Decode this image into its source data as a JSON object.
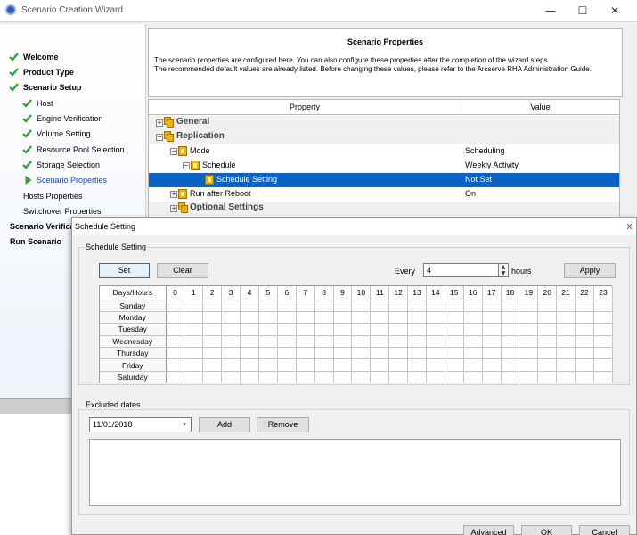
{
  "window": {
    "title": "Scenario Creation Wizard",
    "min": "—",
    "max": "☐",
    "close": "✕"
  },
  "steps": [
    {
      "label": "Welcome",
      "check": true
    },
    {
      "label": "Product Type",
      "check": true
    },
    {
      "label": "Scenario Setup",
      "check": true
    },
    {
      "label": "Host",
      "check": true
    },
    {
      "label": "Engine Verification",
      "check": true
    },
    {
      "label": "Volume Setting",
      "check": true
    },
    {
      "label": "Resource Pool Selection",
      "check": true
    },
    {
      "label": "Storage Selection",
      "check": true
    },
    {
      "label": "Scenario Properties",
      "check": false
    },
    {
      "label": "Hosts Properties",
      "check": false
    },
    {
      "label": "Switchover Properties",
      "check": false
    },
    {
      "label": "Scenario Verification",
      "check": false
    },
    {
      "label": "Run Scenario",
      "check": false
    }
  ],
  "header": {
    "title": "Scenario Properties",
    "line1": "The scenario properties are configured here. You can also configure these properties after the completion of the wizard steps.",
    "line2": "The recommended default values are already listed. Before changing these values, please refer to the Arcserve RHA Administration Guide."
  },
  "grid": {
    "col_property": "Property",
    "col_value": "Value",
    "rows": [
      {
        "name": "General",
        "value": "",
        "pm": "+"
      },
      {
        "name": "Replication",
        "value": "",
        "pm": "−"
      },
      {
        "name": "Mode",
        "value": "Scheduling",
        "pm": "−"
      },
      {
        "name": "Schedule",
        "value": "Weekly Activity",
        "pm": "−"
      },
      {
        "name": "Schedule Setting",
        "value": "Not Set",
        "pm": ""
      },
      {
        "name": "Run after Reboot",
        "value": "On",
        "pm": "+"
      },
      {
        "name": "Optional Settings",
        "value": "",
        "pm": "+"
      }
    ]
  },
  "dialog": {
    "title": "Schedule Setting",
    "close": "x",
    "schedule_group": "Schedule Setting",
    "set": "Set",
    "clear": "Clear",
    "every": "Every",
    "every_value": "4",
    "spin_up": "▲",
    "spin_down": "▼",
    "hours": "hours",
    "apply": "Apply",
    "days_hours": "Days/Hours",
    "hours_list": [
      "0",
      "1",
      "2",
      "3",
      "4",
      "5",
      "6",
      "7",
      "8",
      "9",
      "10",
      "11",
      "12",
      "13",
      "14",
      "15",
      "16",
      "17",
      "18",
      "19",
      "20",
      "21",
      "22",
      "23"
    ],
    "days": [
      "Sunday",
      "Monday",
      "Tuesday",
      "Wednesday",
      "Thursday",
      "Friday",
      "Saturday"
    ],
    "excluded_group": "Excluded dates",
    "date_value": "11/01/2018",
    "date_drop": "▾",
    "add": "Add",
    "remove": "Remove",
    "advanced": "Advanced",
    "ok": "OK",
    "cancel": "Cancel"
  },
  "colors": {
    "selection": "#0a64c8",
    "check": "#2e9e2e",
    "accent": "#1c47a6"
  }
}
